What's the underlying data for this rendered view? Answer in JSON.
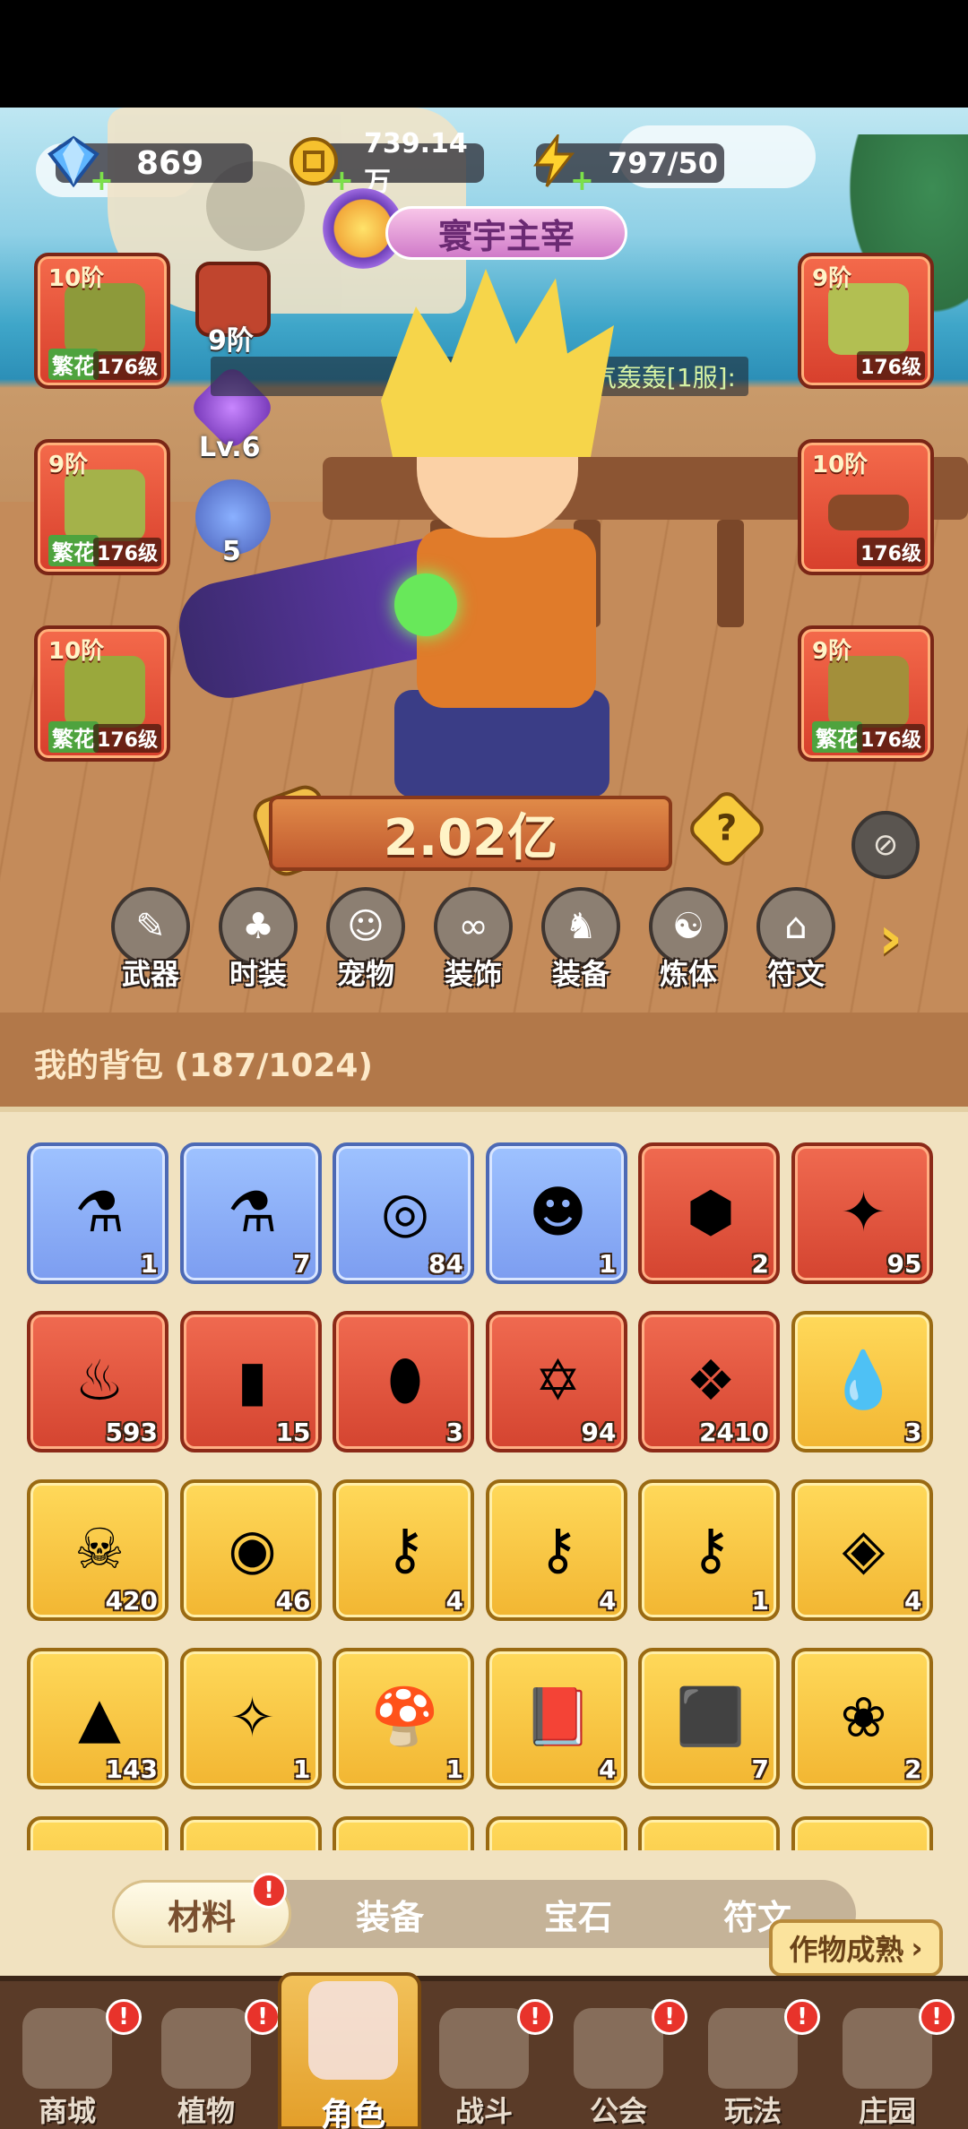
{
  "currencies": [
    {
      "icon": "diamond-icon",
      "value": "869"
    },
    {
      "icon": "gold-coin-icon",
      "value": "739.14万"
    },
    {
      "icon": "energy-bolt-icon",
      "value": "797/50"
    }
  ],
  "hero": {
    "title": "寰宇主宰",
    "guild_text": "牛气轰轰[1服]:",
    "rank_label": "9阶",
    "level_label": "Lv.6",
    "star_count": "5",
    "power": "2.02亿"
  },
  "equipment_left": [
    {
      "tier": "10阶",
      "tag": "繁花",
      "level": "176级",
      "slot": "hat"
    },
    {
      "tier": "9阶",
      "tag": "繁花",
      "level": "176级",
      "slot": "gloves"
    },
    {
      "tier": "10阶",
      "tag": "繁花",
      "level": "176级",
      "slot": "pants"
    }
  ],
  "equipment_right": [
    {
      "tier": "9阶",
      "tag": "",
      "level": "176级",
      "slot": "shirt"
    },
    {
      "tier": "10阶",
      "tag": "",
      "level": "176级",
      "slot": "belt"
    },
    {
      "tier": "9阶",
      "tag": "繁花",
      "level": "176级",
      "slot": "boots"
    }
  ],
  "categories": [
    "武器",
    "时装",
    "宠物",
    "装饰",
    "装备",
    "炼体",
    "符文"
  ],
  "bag": {
    "title": "我的背包 (187/1024)",
    "items": [
      {
        "rarity": "blue",
        "icon": "potion-vial-icon",
        "glyph": "⚗",
        "count": "1"
      },
      {
        "rarity": "blue",
        "icon": "vial-wing-icon",
        "glyph": "⚗",
        "count": "7"
      },
      {
        "rarity": "blue",
        "icon": "orbit-ring-icon",
        "glyph": "◎",
        "count": "84"
      },
      {
        "rarity": "blue",
        "icon": "hero-card-icon",
        "glyph": "☻",
        "count": "1"
      },
      {
        "rarity": "red",
        "icon": "red-cube-icon",
        "glyph": "⬢",
        "count": "2"
      },
      {
        "rarity": "red",
        "icon": "blue-star-icon",
        "glyph": "✦",
        "count": "95"
      },
      {
        "rarity": "red",
        "icon": "red-flask-icon",
        "glyph": "♨",
        "count": "593"
      },
      {
        "rarity": "red",
        "icon": "green-tube-icon",
        "glyph": "▮",
        "count": "15"
      },
      {
        "rarity": "red",
        "icon": "green-capsule-icon",
        "glyph": "⬮",
        "count": "3"
      },
      {
        "rarity": "red",
        "icon": "hexagram-crystal-icon",
        "glyph": "✡",
        "count": "94"
      },
      {
        "rarity": "red",
        "icon": "purple-cubes-icon",
        "glyph": "❖",
        "count": "2410"
      },
      {
        "rarity": "gold",
        "icon": "water-drop-icon",
        "glyph": "💧",
        "count": "3"
      },
      {
        "rarity": "gold",
        "icon": "skull-scroll-icon",
        "glyph": "☠",
        "count": "420"
      },
      {
        "rarity": "gold",
        "icon": "gold-coin-icon",
        "glyph": "◉",
        "count": "46"
      },
      {
        "rarity": "gold",
        "icon": "ruby-key-icon",
        "glyph": "⚷",
        "count": "4"
      },
      {
        "rarity": "gold",
        "icon": "purple-key-icon",
        "glyph": "⚷",
        "count": "4"
      },
      {
        "rarity": "gold",
        "icon": "green-key-icon",
        "glyph": "⚷",
        "count": "1"
      },
      {
        "rarity": "gold",
        "icon": "gold-cube-icon",
        "glyph": "◈",
        "count": "4"
      },
      {
        "rarity": "gold",
        "icon": "fire-prism-icon",
        "glyph": "▲",
        "count": "143"
      },
      {
        "rarity": "gold",
        "icon": "star-orb-icon",
        "glyph": "✧",
        "count": "1"
      },
      {
        "rarity": "gold",
        "icon": "mushroom-icon",
        "glyph": "🍄",
        "count": "1"
      },
      {
        "rarity": "gold",
        "icon": "red-book-icon",
        "glyph": "📕",
        "count": "4"
      },
      {
        "rarity": "gold",
        "icon": "green-cube-icon",
        "glyph": "⬛",
        "count": "7"
      },
      {
        "rarity": "gold",
        "icon": "golden-flower-icon",
        "glyph": "❀",
        "count": "2"
      }
    ],
    "partial_row": [
      "gold",
      "gold",
      "gold",
      "gold",
      "gold",
      "gold"
    ]
  },
  "tabs": [
    {
      "label": "材料",
      "active": true,
      "badge": "!"
    },
    {
      "label": "装备",
      "active": false
    },
    {
      "label": "宝石",
      "active": false
    },
    {
      "label": "符文",
      "active": false
    }
  ],
  "ripe_button": {
    "label": "作物成熟",
    "arrow": "›"
  },
  "nav": [
    {
      "label": "商城",
      "badge": "!",
      "active": false
    },
    {
      "label": "植物",
      "badge": "!",
      "active": false
    },
    {
      "label": "角色",
      "badge": "",
      "active": true
    },
    {
      "label": "战斗",
      "badge": "!",
      "active": false
    },
    {
      "label": "公会",
      "badge": "!",
      "active": false
    },
    {
      "label": "玩法",
      "badge": "!",
      "active": false
    },
    {
      "label": "庄园",
      "badge": "!",
      "active": false
    }
  ],
  "colors": {
    "accent_gold": "#f2bf49",
    "badge_red": "#e8332b",
    "panel_bg": "#f1e2c0"
  }
}
